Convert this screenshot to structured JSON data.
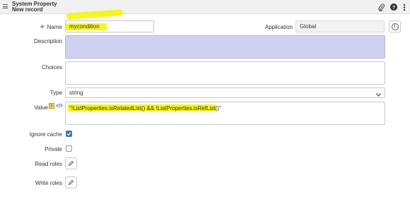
{
  "header": {
    "title": "System Property",
    "subtitle": "New record",
    "icons": [
      "hamburger-menu-icon",
      "paperclip-icon",
      "help-icon",
      "more-icon"
    ]
  },
  "form": {
    "name": {
      "label": "Name",
      "value": "mycondition",
      "required_marker": "✳"
    },
    "application": {
      "label": "Application",
      "value": "Global"
    },
    "description": {
      "label": "Description",
      "value": ""
    },
    "choices": {
      "label": "Choices",
      "value": ""
    },
    "type": {
      "label": "Type",
      "value": "string"
    },
    "value": {
      "label": "Value",
      "value": "\"!ListProperties.isRelatedList() && !ListProperties.isRefList()\""
    },
    "ignore_cache": {
      "label": "Ignore cache",
      "checked": true
    },
    "private": {
      "label": "Private",
      "checked": false
    },
    "read_roles": {
      "label": "Read roles"
    },
    "write_roles": {
      "label": "Write roles"
    }
  },
  "colors": {
    "highlight": "#f4f300",
    "checkbox_checked": "#4a6fb5",
    "mandatory_field": "#d0d0f0"
  }
}
